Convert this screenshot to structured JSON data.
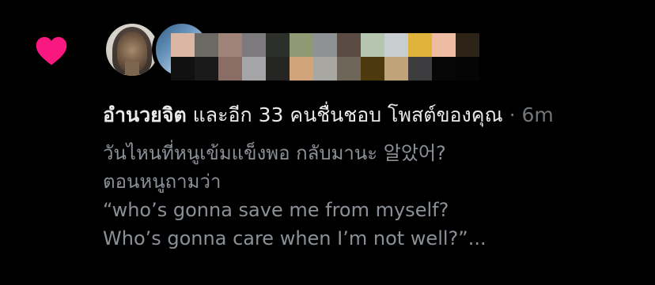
{
  "notification": {
    "icon": "heart-icon",
    "icon_color": "#f91880",
    "liker_name": "อำนวยจิต",
    "action_text": " และอีก 33 คนชื่นชอบ โพสต์ของคุณ",
    "separator": " · ",
    "timestamp": "6m",
    "post_preview_lines": [
      "วันไหนที่หนูเข้มแข็งพอ กลับมานะ 알았어?",
      "ตอนหนูถามว่า",
      "“who’s gonna save me from myself?",
      "Who’s gonna care when I’m not well?”..."
    ]
  },
  "colors": {
    "background": "#000000",
    "primary_text": "#e7e9ea",
    "secondary_text": "#71767b",
    "preview_text": "#8b9096",
    "like_pink": "#f91880"
  },
  "pixelated_block_colors": [
    "#dcb6a4",
    "#6c6964",
    "#9f8278",
    "#7d7a7d",
    "#2c2f2a",
    "#8f9a74",
    "#8e9295",
    "#5a4c42",
    "#b5c5b0",
    "#c8cdd0",
    "#e0b33a",
    "#eebba3",
    "#2c2316",
    "#000000",
    "#111111",
    "#1a1a1a",
    "#8a6e66",
    "#a5a4a6",
    "#252624",
    "#d2a47a",
    "#a9a7a2",
    "#6e6658",
    "#4c3a0e",
    "#c0a378",
    "#3d3d3f",
    "#060606",
    "#050505",
    "#000000"
  ]
}
